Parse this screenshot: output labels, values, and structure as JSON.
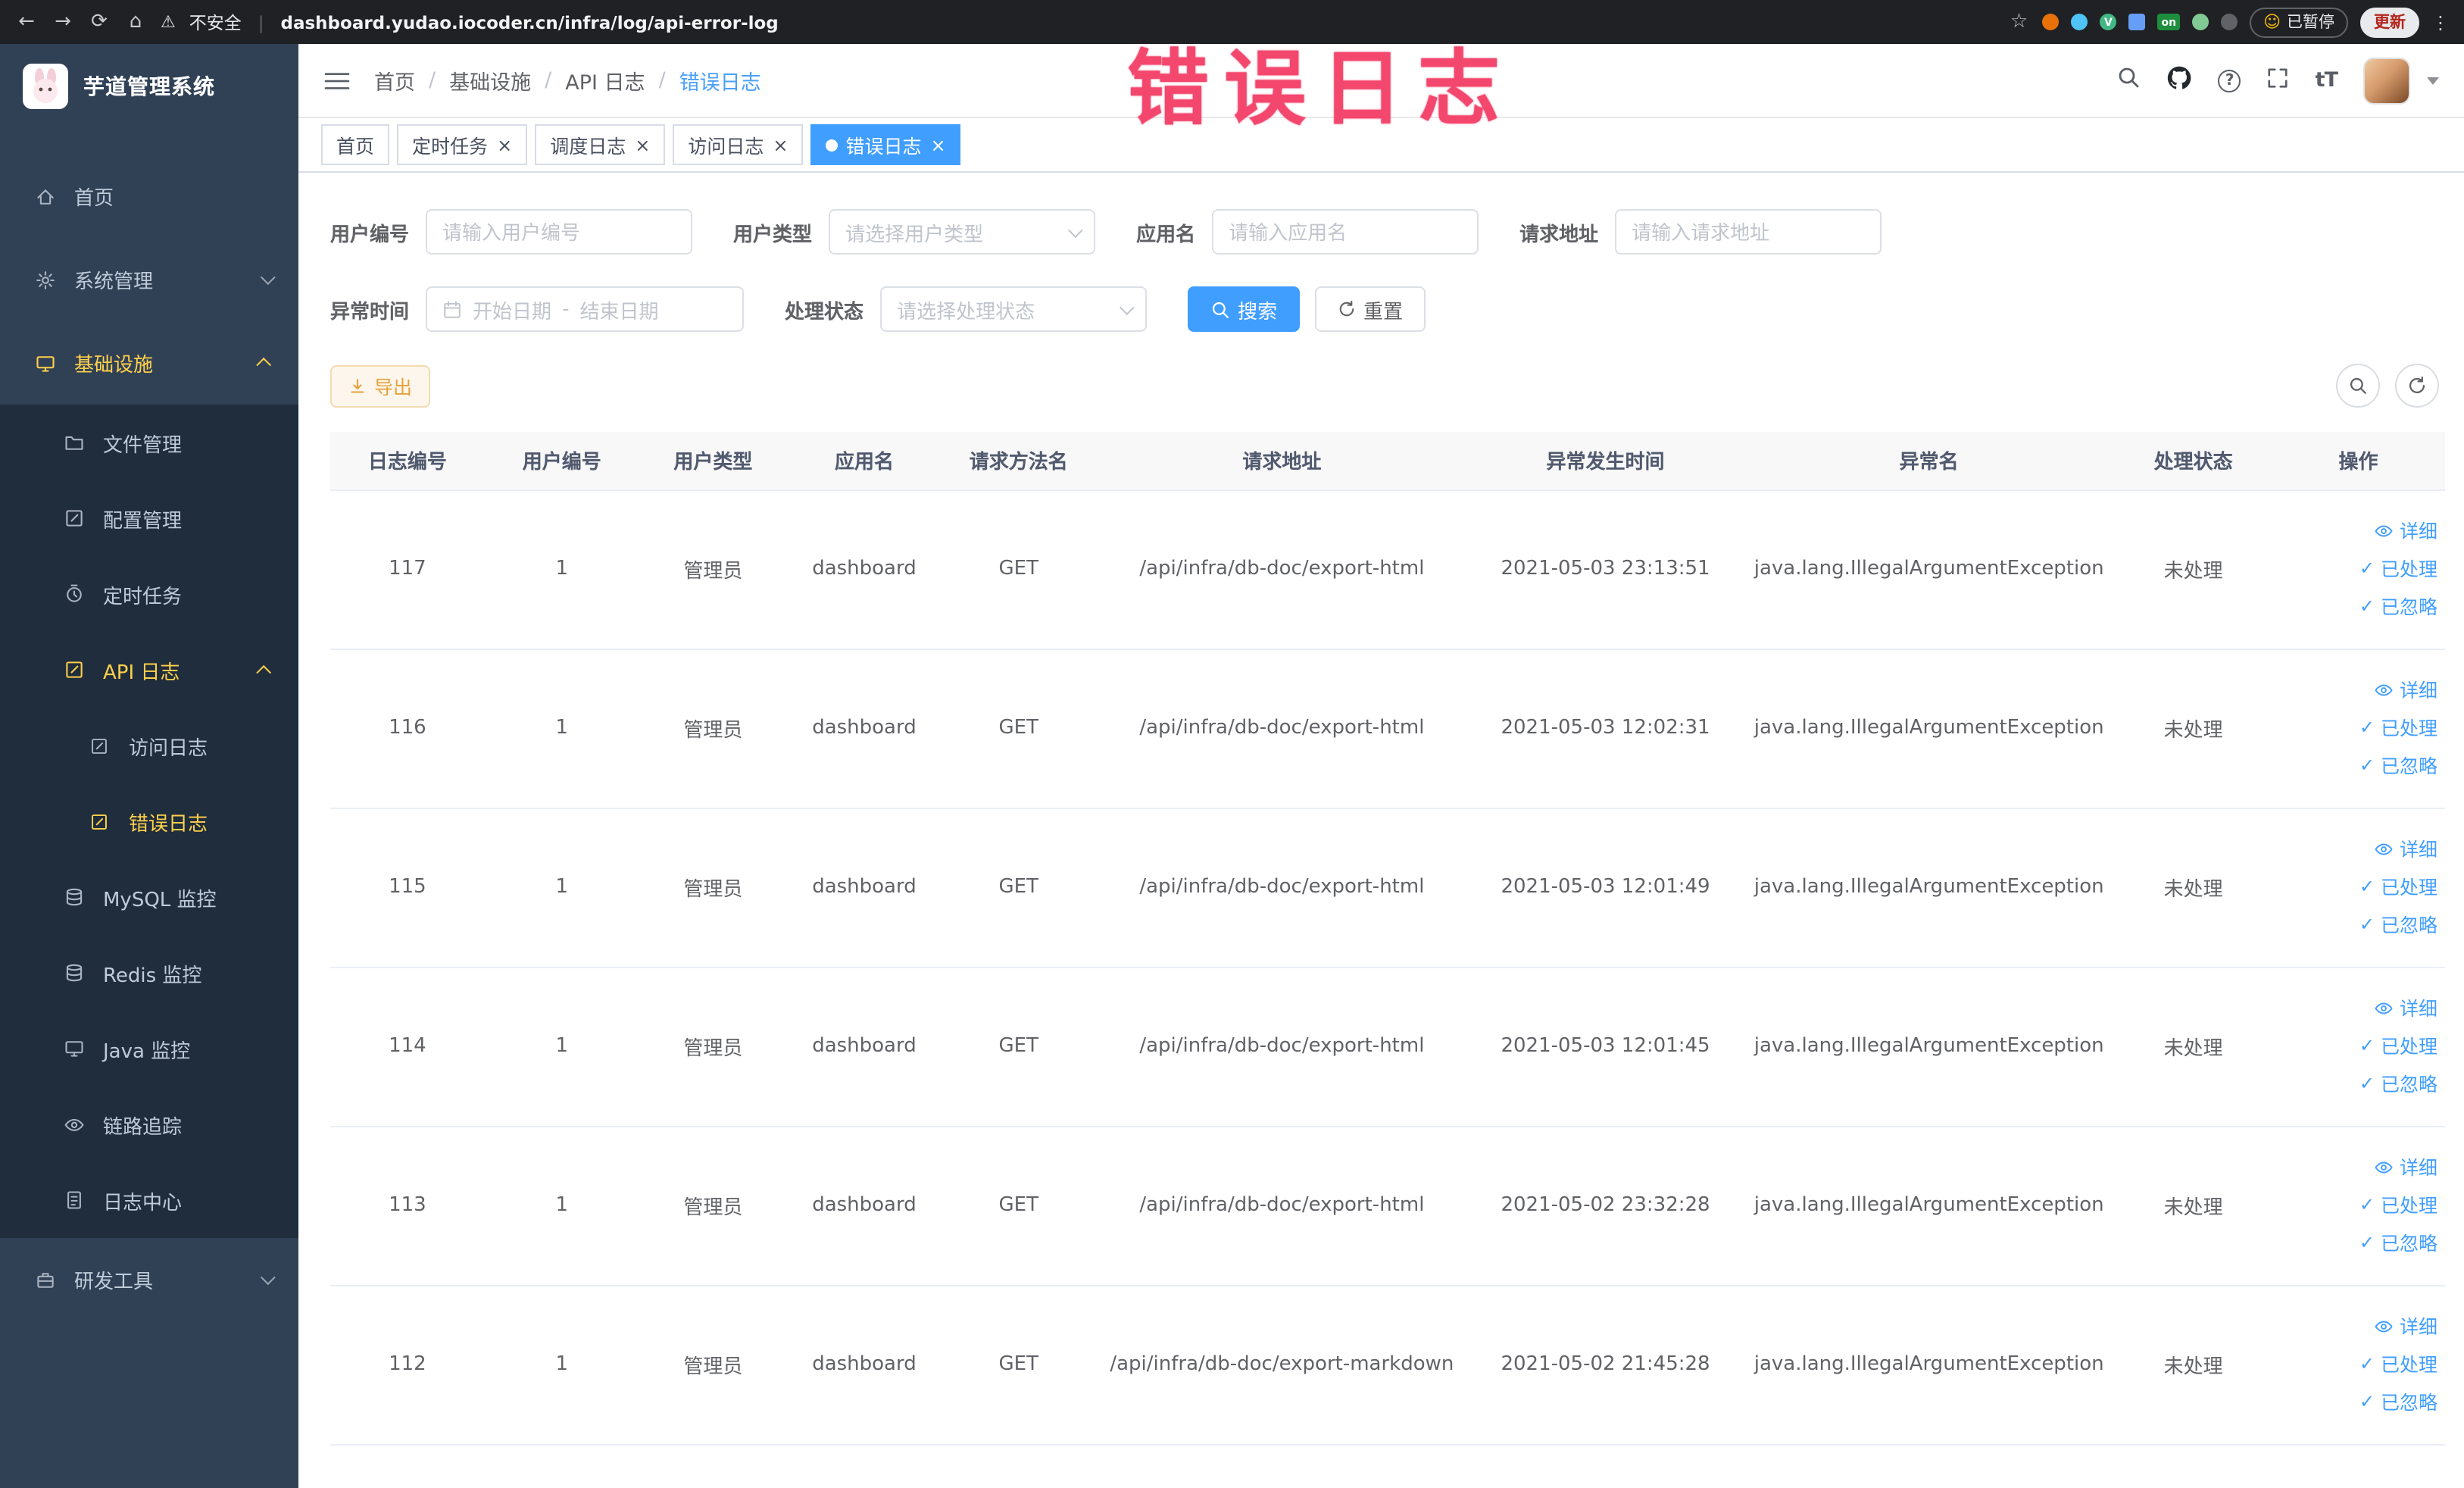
{
  "colors": {
    "accent": "#409eff",
    "sidebar_bg": "#304156",
    "sidebar_submenu_bg": "#1f2d3d",
    "sidebar_active_text": "#ffd04b",
    "warning": "#e6a23c",
    "annotation": "#f3476e",
    "chrome_bg": "#202124"
  },
  "icons": {
    "back": "←",
    "forward": "→",
    "reload": "⟳",
    "home": "⌂",
    "warning": "⚠",
    "star": "☆",
    "overflow": "⋮",
    "smiley": "☺",
    "close": "×",
    "check": "✓",
    "vue": "V",
    "separator": "|",
    "slash": "/"
  },
  "annotation": {
    "text": "错误日志"
  },
  "browser": {
    "security_label": "不安全",
    "url": "dashboard.yudao.iocoder.cn/infra/log/api-error-log",
    "on_badge": "on",
    "paused_label": "已暂停",
    "update_label": "更新"
  },
  "sidebar": {
    "logo_title": "芋道管理系统",
    "items": [
      {
        "label": "首页"
      },
      {
        "label": "系统管理"
      },
      {
        "label": "基础设施"
      },
      {
        "label": "文件管理"
      },
      {
        "label": "配置管理"
      },
      {
        "label": "定时任务"
      },
      {
        "label": "API 日志"
      },
      {
        "label": "访问日志"
      },
      {
        "label": "错误日志"
      },
      {
        "label": "MySQL 监控"
      },
      {
        "label": "Redis 监控"
      },
      {
        "label": "Java 监控"
      },
      {
        "label": "链路追踪"
      },
      {
        "label": "日志中心"
      },
      {
        "label": "研发工具"
      }
    ]
  },
  "header": {
    "breadcrumbs": [
      "首页",
      "基础设施",
      "API 日志",
      "错误日志"
    ]
  },
  "tabs": [
    {
      "label": "首页"
    },
    {
      "label": "定时任务"
    },
    {
      "label": "调度日志"
    },
    {
      "label": "访问日志"
    },
    {
      "label": "错误日志"
    }
  ],
  "filters": {
    "user_id": {
      "label": "用户编号",
      "placeholder": "请输入用户编号"
    },
    "user_type": {
      "label": "用户类型",
      "placeholder": "请选择用户类型"
    },
    "app_name": {
      "label": "应用名",
      "placeholder": "请输入应用名"
    },
    "request_url": {
      "label": "请求地址",
      "placeholder": "请输入请求地址"
    },
    "exception_time": {
      "label": "异常时间",
      "start_placeholder": "开始日期",
      "end_placeholder": "结束日期",
      "range_separator": "-"
    },
    "process_status": {
      "label": "处理状态",
      "placeholder": "请选择处理状态"
    },
    "search_label": "搜索",
    "reset_label": "重置"
  },
  "toolbar": {
    "export_label": "导出"
  },
  "table": {
    "columns": [
      "日志编号",
      "用户编号",
      "用户类型",
      "应用名",
      "请求方法名",
      "请求地址",
      "异常发生时间",
      "异常名",
      "处理状态",
      "操作"
    ],
    "actions": {
      "detail": "详细",
      "processed": "已处理",
      "ignored": "已忽略"
    },
    "rows": [
      {
        "id": "117",
        "user_id": "1",
        "user_type": "管理员",
        "app_name": "dashboard",
        "method": "GET",
        "url": "/api/infra/db-doc/export-html",
        "time": "2021-05-03 23:13:51",
        "exception": "java.lang.IllegalArgumentException",
        "status": "未处理"
      },
      {
        "id": "116",
        "user_id": "1",
        "user_type": "管理员",
        "app_name": "dashboard",
        "method": "GET",
        "url": "/api/infra/db-doc/export-html",
        "time": "2021-05-03 12:02:31",
        "exception": "java.lang.IllegalArgumentException",
        "status": "未处理"
      },
      {
        "id": "115",
        "user_id": "1",
        "user_type": "管理员",
        "app_name": "dashboard",
        "method": "GET",
        "url": "/api/infra/db-doc/export-html",
        "time": "2021-05-03 12:01:49",
        "exception": "java.lang.IllegalArgumentException",
        "status": "未处理"
      },
      {
        "id": "114",
        "user_id": "1",
        "user_type": "管理员",
        "app_name": "dashboard",
        "method": "GET",
        "url": "/api/infra/db-doc/export-html",
        "time": "2021-05-03 12:01:45",
        "exception": "java.lang.IllegalArgumentException",
        "status": "未处理"
      },
      {
        "id": "113",
        "user_id": "1",
        "user_type": "管理员",
        "app_name": "dashboard",
        "method": "GET",
        "url": "/api/infra/db-doc/export-html",
        "time": "2021-05-02 23:32:28",
        "exception": "java.lang.IllegalArgumentException",
        "status": "未处理"
      },
      {
        "id": "112",
        "user_id": "1",
        "user_type": "管理员",
        "app_name": "dashboard",
        "method": "GET",
        "url": "/api/infra/db-doc/export-markdown",
        "time": "2021-05-02 21:45:28",
        "exception": "java.lang.IllegalArgumentException",
        "status": "未处理"
      }
    ]
  }
}
